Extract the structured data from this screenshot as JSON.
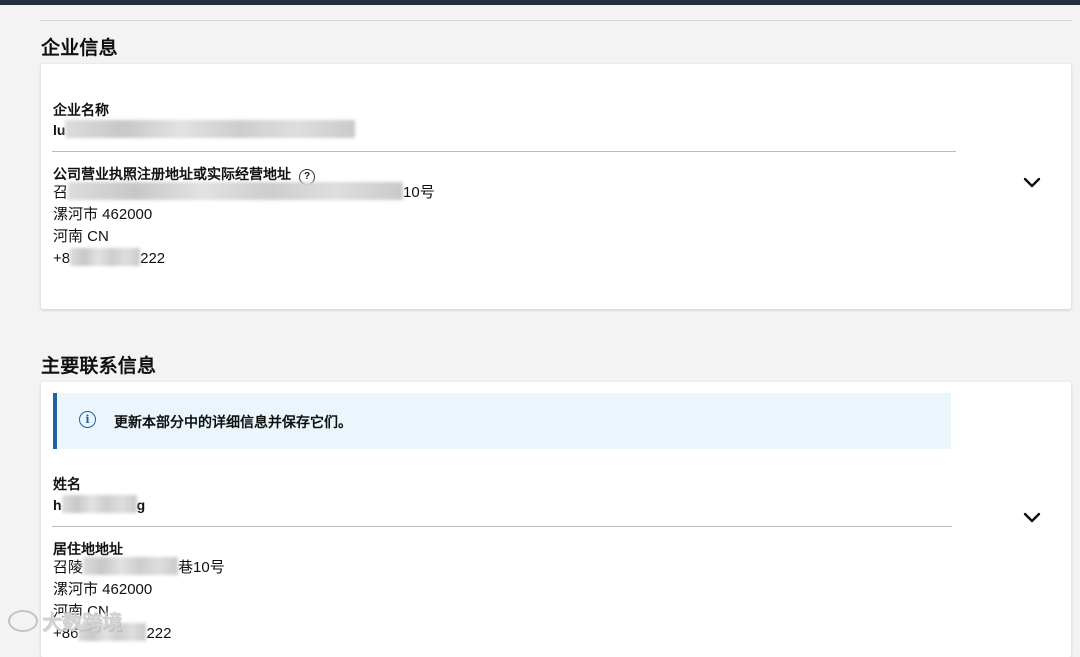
{
  "company_section": {
    "title": "企业信息",
    "company_name_label": "企业名称",
    "company_name_prefix": "lu",
    "address_label": "公司营业执照注册地址或实际经营地址",
    "address_line1_prefix": "召",
    "address_line1_suffix": "10号",
    "address_line2": "漯河市 462000",
    "address_line3": "河南 CN",
    "phone_prefix": "+8",
    "phone_suffix": "222"
  },
  "contact_section": {
    "title": "主要联系信息",
    "alert_text": "更新本部分中的详细信息并保存它们。",
    "name_label": "姓名",
    "name_prefix": "h",
    "name_suffix": "g",
    "residence_label": "居住地地址",
    "residence_line1_prefix": "召陵",
    "residence_line1_suffix": "巷10号",
    "residence_line2": "漯河市 462000",
    "residence_line3": "河南 CN",
    "phone_prefix": "+86",
    "phone_suffix": "222"
  },
  "icons": {
    "help": "help-circle-icon",
    "info": "info-circle-icon",
    "expand": "chevron-down-icon"
  },
  "watermark_text": "大数跨境",
  "colors": {
    "alert_background": "#eaf6fc",
    "alert_border": "#2162a1",
    "page_background": "#f3f3f3"
  }
}
